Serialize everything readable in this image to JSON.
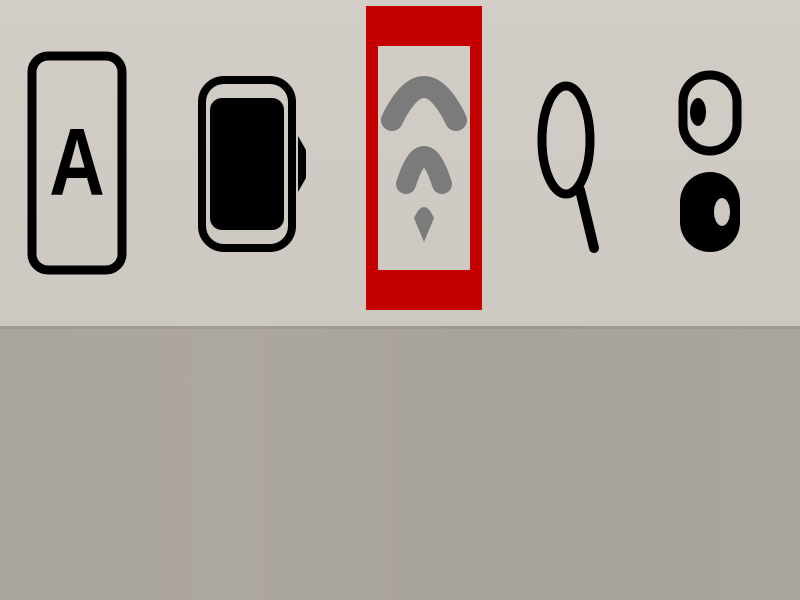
{
  "menubar": {
    "items": [
      {
        "icon": "input-source-icon",
        "label": "A"
      },
      {
        "icon": "battery-icon"
      },
      {
        "icon": "wifi-icon",
        "highlighted": true
      },
      {
        "icon": "spotlight-search-icon"
      },
      {
        "icon": "control-center-icon"
      }
    ]
  },
  "colors": {
    "menubar_bg": "#d2cdc6",
    "desktop_bg": "#a8a39d",
    "icon": "#000000",
    "wifi_icon": "#7b7b7b",
    "highlight_border": "#c40000"
  }
}
